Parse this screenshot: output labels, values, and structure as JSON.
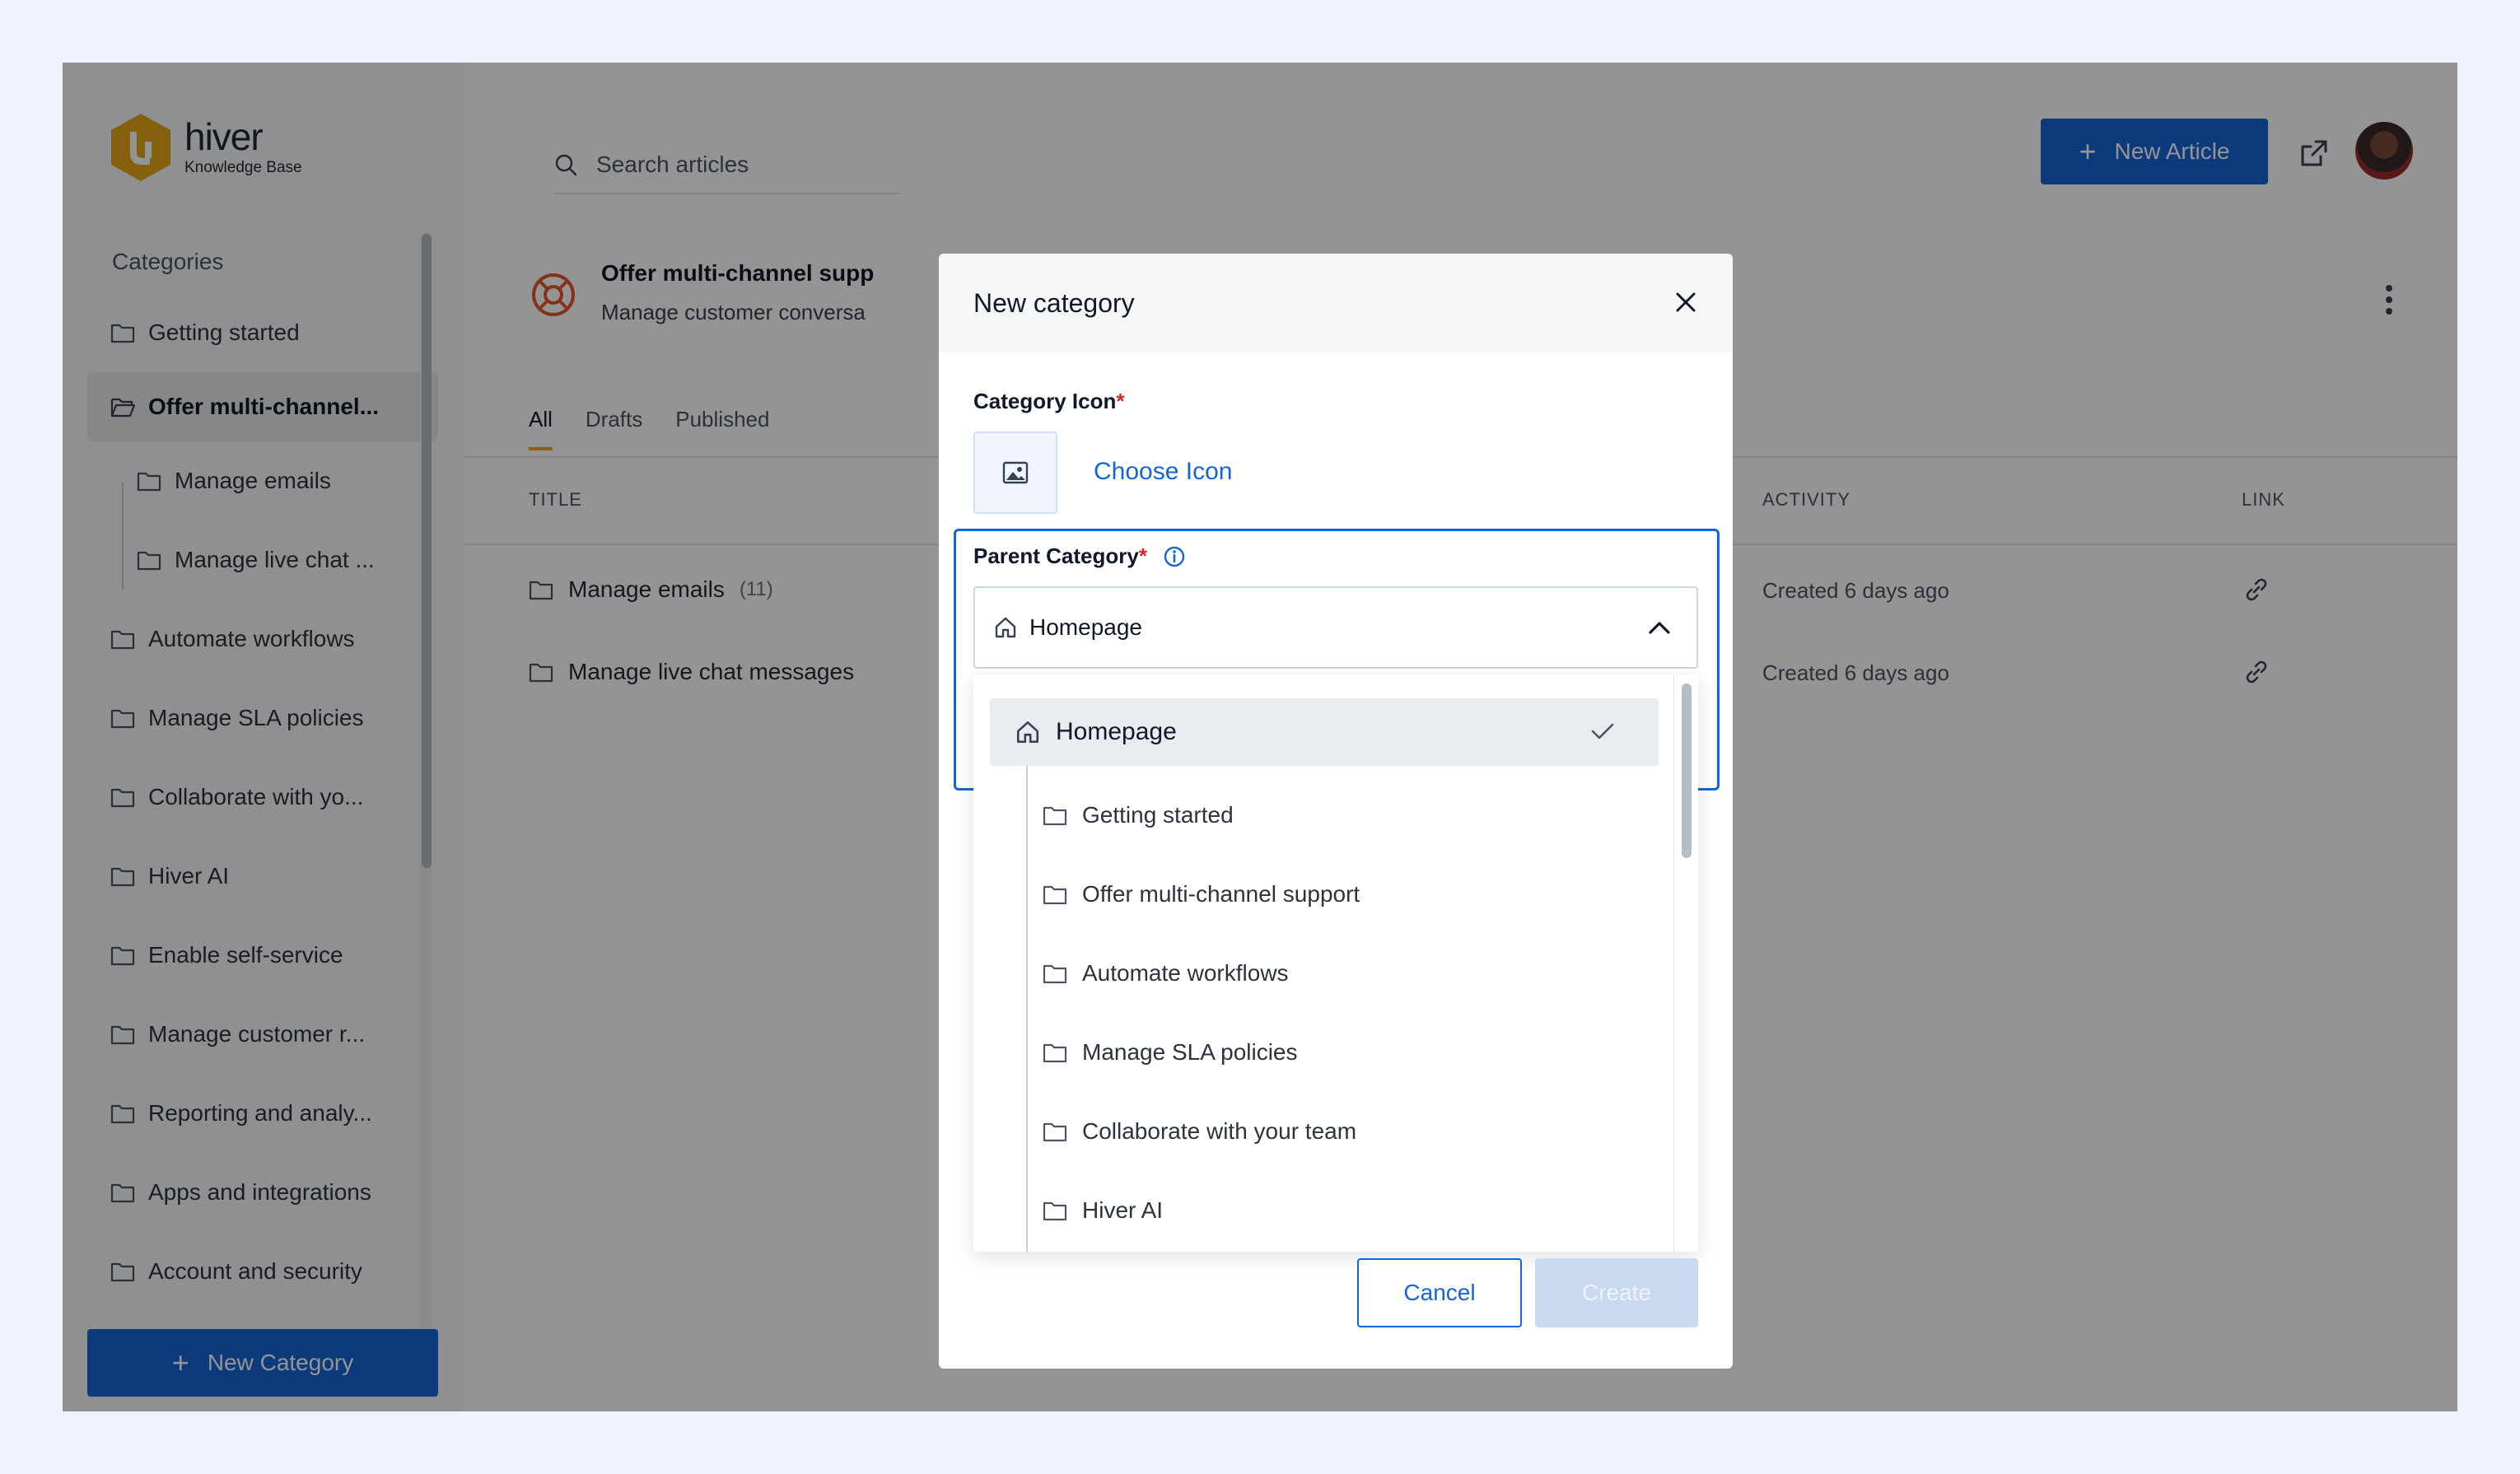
{
  "brand": {
    "name": "hiver",
    "subtitle": "Knowledge Base",
    "color": "#e6a817"
  },
  "sidebar": {
    "heading": "Categories",
    "items": [
      {
        "label": "Getting started"
      },
      {
        "label": "Offer multi-channel..."
      },
      {
        "label": "Manage emails"
      },
      {
        "label": "Manage live chat ..."
      },
      {
        "label": "Automate workflows"
      },
      {
        "label": "Manage SLA policies"
      },
      {
        "label": "Collaborate with yo..."
      },
      {
        "label": "Hiver AI"
      },
      {
        "label": "Enable self-service"
      },
      {
        "label": "Manage customer r..."
      },
      {
        "label": "Reporting and analy..."
      },
      {
        "label": "Apps and integrations"
      },
      {
        "label": "Account and security"
      }
    ],
    "new_category": "New Category"
  },
  "header": {
    "search_placeholder": "Search articles",
    "new_article": "New Article"
  },
  "category": {
    "title": "Offer multi-channel supp",
    "description": "Manage customer conversa"
  },
  "tabs": [
    {
      "label": "All"
    },
    {
      "label": "Drafts"
    },
    {
      "label": "Published"
    }
  ],
  "table": {
    "columns": {
      "title": "TITLE",
      "activity": "ACTIVITY",
      "link": "LINK"
    },
    "rows": [
      {
        "name": "Manage emails",
        "count": "(11)",
        "activity": "Created 6 days ago"
      },
      {
        "name": "Manage live chat messages",
        "count": "",
        "activity": "Created 6 days ago"
      }
    ]
  },
  "modal": {
    "title": "New category",
    "icon_label": "Category Icon",
    "required_mark": "*",
    "choose_icon": "Choose Icon",
    "parent_label": "Parent Category",
    "selected": "Homepage",
    "options": [
      {
        "label": "Homepage"
      },
      {
        "label": "Getting started"
      },
      {
        "label": "Offer multi-channel support"
      },
      {
        "label": "Automate workflows"
      },
      {
        "label": "Manage SLA policies"
      },
      {
        "label": "Collaborate with your team"
      },
      {
        "label": "Hiver AI"
      }
    ],
    "cancel": "Cancel",
    "create": "Create"
  },
  "colors": {
    "primary": "#1565d8",
    "accent": "#e8a428",
    "required": "#dc2626"
  }
}
